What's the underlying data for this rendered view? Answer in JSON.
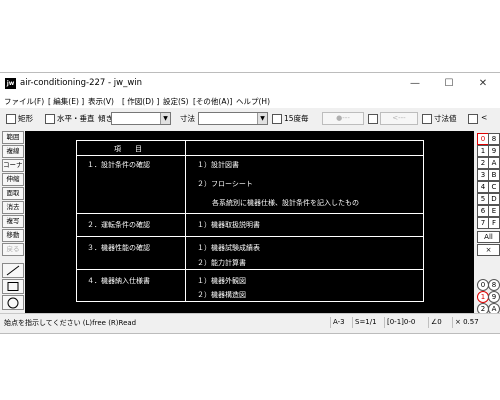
{
  "window": {
    "title": "air-conditioning-227 - jw_win",
    "app_icon_text": "jw"
  },
  "menu": [
    "ファイル(F)",
    "[ 編集(E) ]",
    "表示(V)",
    "[ 作図(D) ]",
    "設定(S)",
    "[その他(A)]",
    "ヘルプ(H)"
  ],
  "toolbar": {
    "rect_label": "矩形",
    "hv_label": "水平・垂直",
    "tilt_label": "傾き",
    "dim_label": "寸法",
    "deg15_label": "15度毎",
    "disabled_box1": "●---",
    "disabled_box2": "<---",
    "dimval_label": "寸法値",
    "less_label": "<"
  },
  "left_tools": [
    "範囲",
    "複線",
    "コーナー",
    "伸縮",
    "面取",
    "消去",
    "複写",
    "移動",
    "戻る"
  ],
  "right_tools": {
    "col1": [
      "0",
      "1",
      "2",
      "3",
      "4",
      "5",
      "6",
      "7"
    ],
    "col2": [
      "8",
      "9",
      "A",
      "B",
      "C",
      "D",
      "E",
      "F"
    ],
    "all": "All",
    "x": "×",
    "circle_labels": [
      "0",
      "1",
      "2"
    ],
    "circle_labels2": [
      "8",
      "9",
      "A"
    ]
  },
  "drawing": {
    "header": "項　　目",
    "rows": [
      {
        "item": "１．設計条件の確認",
        "details": [
          "１）設計図書",
          "２）フローシート",
          "各系統別に機器仕様、設計条件を記入したもの"
        ]
      },
      {
        "item": "２．運転条件の確認",
        "details": [
          "１）機器取扱説明書"
        ]
      },
      {
        "item": "３．機器性能の確認",
        "details": [
          "１）機器試験成績表",
          "２）能力計算書"
        ]
      },
      {
        "item": "４．機器納入仕様書",
        "details": [
          "１）機器外観図",
          "２）機器構造図"
        ]
      }
    ]
  },
  "status": {
    "message": "始点を指示してください (L)free (R)Read",
    "paper": "A-3",
    "scale": "S=1/1",
    "layer": "[0-1]0-0",
    "angle": "∠0",
    "zoom": "× 0.57"
  }
}
